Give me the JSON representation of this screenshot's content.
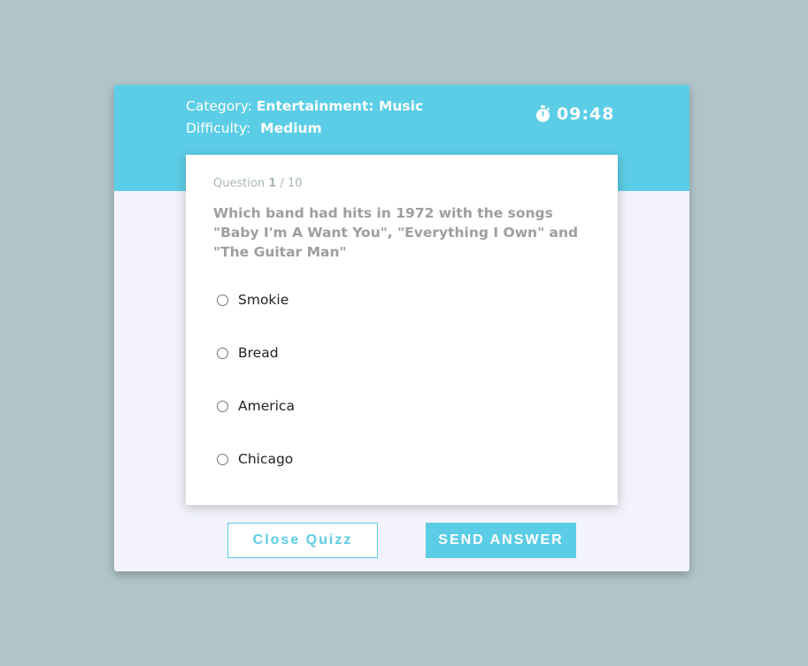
{
  "quiz": {
    "category_label": "Category:",
    "category_value": "Entertainment: Music",
    "difficulty_label": "Difficulty:",
    "difficulty_value": "Medium",
    "timer": "09:48",
    "timer_icon": "stopwatch-icon"
  },
  "question": {
    "label": "Question",
    "current": "1",
    "separator": "/",
    "total": "10",
    "text": "Which band had hits in 1972 with the songs \"Baby I'm A Want You\", \"Everything I Own\" and \"The Guitar Man\""
  },
  "options": [
    {
      "label": "Smokie",
      "selected": false
    },
    {
      "label": "Bread",
      "selected": false
    },
    {
      "label": "America",
      "selected": false
    },
    {
      "label": "Chicago",
      "selected": false
    }
  ],
  "buttons": {
    "close": "Close Quizz",
    "send": "SEND ANSWER"
  },
  "colors": {
    "background": "#b0c4ca",
    "accent": "#5ccde6",
    "panel": "#f2f3fb"
  }
}
